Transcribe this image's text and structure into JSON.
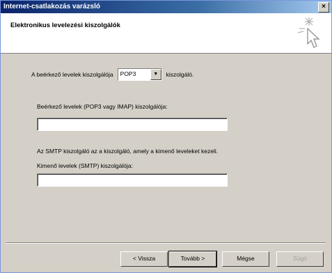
{
  "window": {
    "title": "Internet-csatlakozás varázsló",
    "close_glyph": "×"
  },
  "header": {
    "title": "Elektronikus levelezési kiszolgálók",
    "icon": "wizard-cursor-icon"
  },
  "incoming_type": {
    "prefix": "A beérkező levelek kiszolgálója",
    "selected": "POP3",
    "suffix": "kiszolgáló."
  },
  "incoming_server": {
    "label": "Beérkező levelek (POP3 vagy IMAP) kiszolgálója:",
    "value": ""
  },
  "smtp_info": "Az SMTP kiszolgáló az a kiszolgáló, amely a kimenő leveleket kezeli.",
  "outgoing_server": {
    "label": "Kimenő levelek (SMTP) kiszolgálója:",
    "value": ""
  },
  "buttons": {
    "back": "< Vissza",
    "next": "Tovább >",
    "cancel": "Mégse",
    "help": "Súgó"
  }
}
